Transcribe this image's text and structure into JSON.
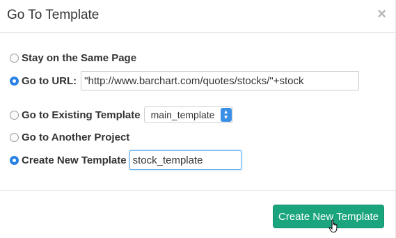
{
  "dialog": {
    "title": "Go To Template",
    "close_symbol": "×"
  },
  "options": {
    "stay": {
      "label": "Stay on the Same Page",
      "checked": false
    },
    "url": {
      "label": "Go to URL:",
      "checked": true,
      "value": "\"http://www.barchart.com/quotes/stocks/\"+stock"
    },
    "existing": {
      "label": "Go to Existing Template",
      "checked": false,
      "selected": "main_template"
    },
    "project": {
      "label": "Go to Another Project",
      "checked": false
    },
    "create": {
      "label": "Create New Template",
      "checked": true,
      "value": "stock_template"
    }
  },
  "footer": {
    "button_label": "Create New Template"
  },
  "icons": {
    "close": "close-icon",
    "select_arrows": "chevron-up-down-icon",
    "cursor": "hand-pointer-cursor-icon"
  },
  "colors": {
    "primary_button": "#1aa57e",
    "radio_checked": "#2a82e4",
    "select_arrow": "#3a8ee6",
    "focus_border": "#66afe9"
  }
}
